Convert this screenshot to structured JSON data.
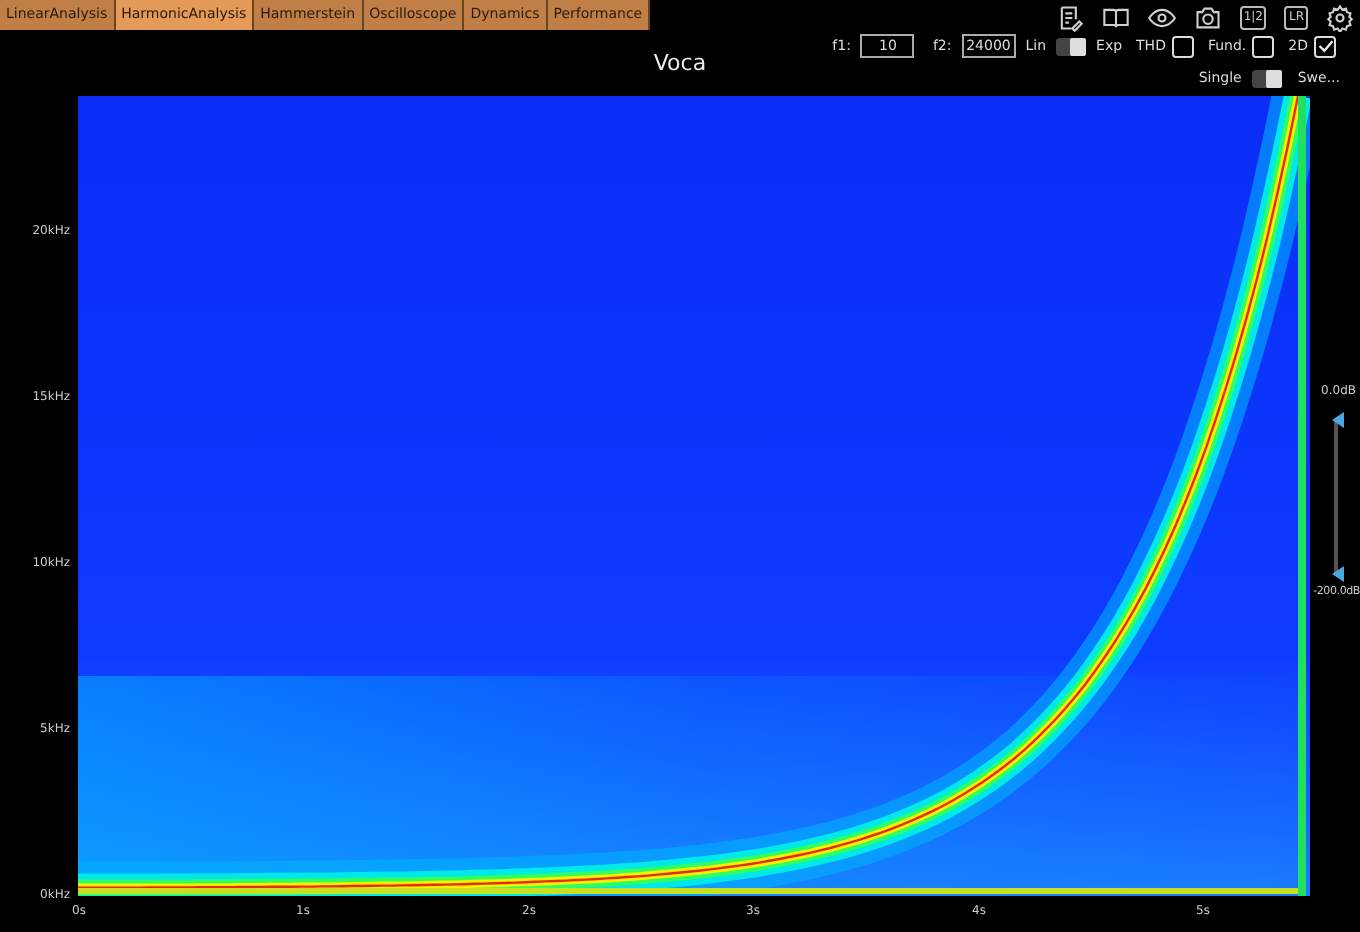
{
  "tabs": [
    {
      "label": "LinearAnalysis",
      "selected": false
    },
    {
      "label": "HarmonicAnalysis",
      "selected": true
    },
    {
      "label": "Hammerstein",
      "selected": false
    },
    {
      "label": "Oscilloscope",
      "selected": false
    },
    {
      "label": "Dynamics",
      "selected": false
    },
    {
      "label": "Performance",
      "selected": false
    }
  ],
  "toolbar": [
    {
      "kind": "notes"
    },
    {
      "kind": "book"
    },
    {
      "kind": "eye"
    },
    {
      "kind": "camera"
    },
    {
      "kind": "text",
      "label": "1|2"
    },
    {
      "kind": "text",
      "label": "LR"
    },
    {
      "kind": "gear"
    }
  ],
  "title": "Voca",
  "controls": {
    "f1_label": "f1:",
    "f1_value": "10",
    "f2_label": "f2:",
    "f2_value": "24000",
    "scale_switch": {
      "left_label": "Lin",
      "right_label": "Exp",
      "on": true
    },
    "checkboxes": [
      {
        "label": "THD",
        "checked": false
      },
      {
        "label": "Fund.",
        "checked": false
      },
      {
        "label": "2D",
        "checked": true
      }
    ],
    "mode_switch": {
      "left_label": "Single",
      "right_label": "Swe...",
      "on": true
    }
  },
  "plot": {
    "yticks": [
      "20kHz",
      "15kHz",
      "10kHz",
      "5kHz",
      "0kHz"
    ],
    "xticks": [
      "0s",
      "1s",
      "2s",
      "3s",
      "4s",
      "5s"
    ]
  },
  "range_slider": {
    "top_label": "0.0dB",
    "bottom_label": "-200.0dB",
    "handles": [
      {
        "level": 1
      },
      {
        "level": 0
      }
    ]
  }
}
